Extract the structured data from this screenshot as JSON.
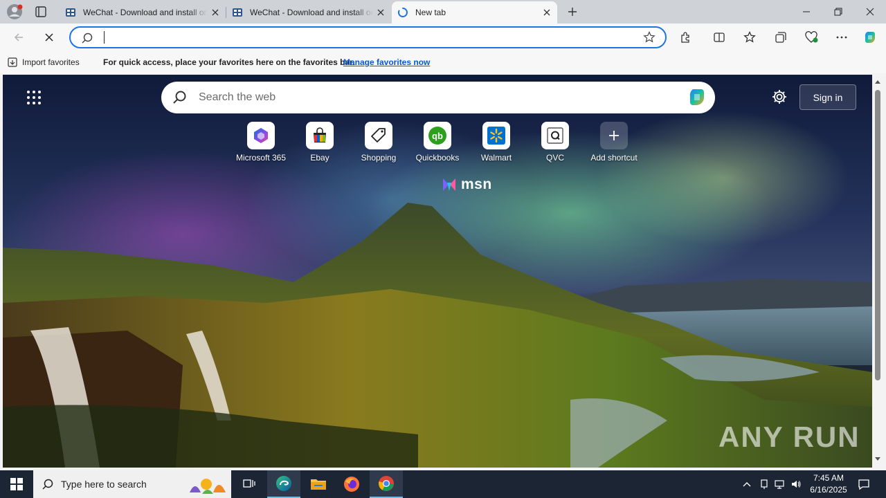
{
  "tabs": [
    {
      "title": "WeChat - Download and install on",
      "state": "inactive"
    },
    {
      "title": "WeChat - Download and install on",
      "state": "inactive"
    },
    {
      "title": "New tab",
      "state": "active"
    }
  ],
  "favorites_bar": {
    "import_label": "Import favorites",
    "message": "For quick access, place your favorites here on the favorites bar.",
    "manage_link": "Manage favorites now"
  },
  "newtab": {
    "search_placeholder": "Search the web",
    "sign_in": "Sign in",
    "shortcuts": [
      {
        "label": "Microsoft 365",
        "icon": "microsoft365-icon"
      },
      {
        "label": "Ebay",
        "icon": "ebay-icon"
      },
      {
        "label": "Shopping",
        "icon": "shopping-tag-icon"
      },
      {
        "label": "Quickbooks",
        "icon": "quickbooks-icon"
      },
      {
        "label": "Walmart",
        "icon": "walmart-icon"
      },
      {
        "label": "QVC",
        "icon": "qvc-icon"
      },
      {
        "label": "Add shortcut",
        "icon": "plus-icon"
      }
    ],
    "brand": "msn",
    "watermark": "ANY RUN"
  },
  "taskbar": {
    "search_text": "Type here to search",
    "time": "7:45 AM",
    "date": "6/16/2025"
  },
  "colors": {
    "accent": "#1a73e8",
    "taskbar": "#1c2533",
    "quickbooks": "#2ca01c",
    "walmart": "#0071ce"
  }
}
